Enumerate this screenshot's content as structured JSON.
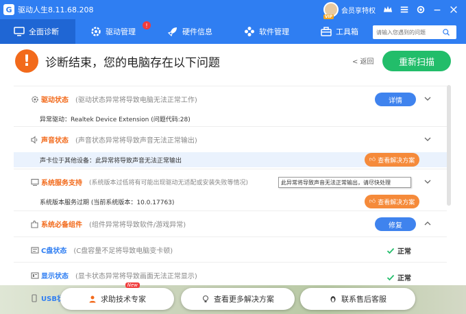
{
  "window": {
    "title": "驱动人生8.11.68.208",
    "logo_glyph": "G",
    "vip_badge": "VIP",
    "member_label": "会员享特权"
  },
  "nav": {
    "tabs": [
      {
        "label": "全面诊断",
        "icon": "monitor-icon",
        "active": true
      },
      {
        "label": "驱动管理",
        "icon": "gear-icon",
        "badge": "!"
      },
      {
        "label": "硬件信息",
        "icon": "rocket-icon"
      },
      {
        "label": "软件管理",
        "icon": "apps-icon"
      },
      {
        "label": "工具箱",
        "icon": "toolbox-icon"
      }
    ],
    "search_placeholder": "请输入您遇到的问题"
  },
  "header": {
    "warning_glyph": "!",
    "title": "诊断结束，您的电脑存在以下问题",
    "back_label": "< 返回",
    "rescan_label": "重新扫描"
  },
  "rows": {
    "driver": {
      "name": "驱动状态",
      "desc": "(驱动状态异常将导致电脑无法正常工作)",
      "action": "详情",
      "detail": "异常驱动：Realtek Device Extension (问题代码:28)"
    },
    "sound": {
      "name": "声音状态",
      "desc": "(声音状态异常将导致声音无法正常输出)",
      "detail": "声卡位于其他设备：此异常将导致声音无法正常输出",
      "action": "查看解决方案"
    },
    "service": {
      "name": "系统服务支持",
      "desc": "(系统版本过低将有可能出现驱动无适配或安装失败等情况)",
      "detail": "系统版本服务过期 (当前系统版本：10.0.17763)",
      "action": "查看解决方案"
    },
    "components": {
      "name": "系统必备组件",
      "desc": "(组件异常将导致软件/游戏异常)",
      "action": "修复"
    },
    "cdrive": {
      "name": "C盘状态",
      "desc": "(C盘容量不足将导致电脑变卡顿)",
      "status": "正常"
    },
    "display": {
      "name": "显示状态",
      "desc": "(显卡状态异常将导致画面无法正常显示)",
      "status": "正常"
    },
    "usb": {
      "name": "USB状"
    }
  },
  "tooltip": "此异常将导致声音无法正常输出，请尽快处理",
  "bottom": {
    "help_label": "求助技术专家",
    "help_new": "New",
    "more_label": "查看更多解决方案",
    "support_label": "联系售后客服"
  },
  "colors": {
    "primary": "#2f7ef2",
    "warning": "#f26a1b",
    "success": "#22bd6a",
    "action_blue": "#3f83ee",
    "action_orange": "#f58a3a"
  }
}
